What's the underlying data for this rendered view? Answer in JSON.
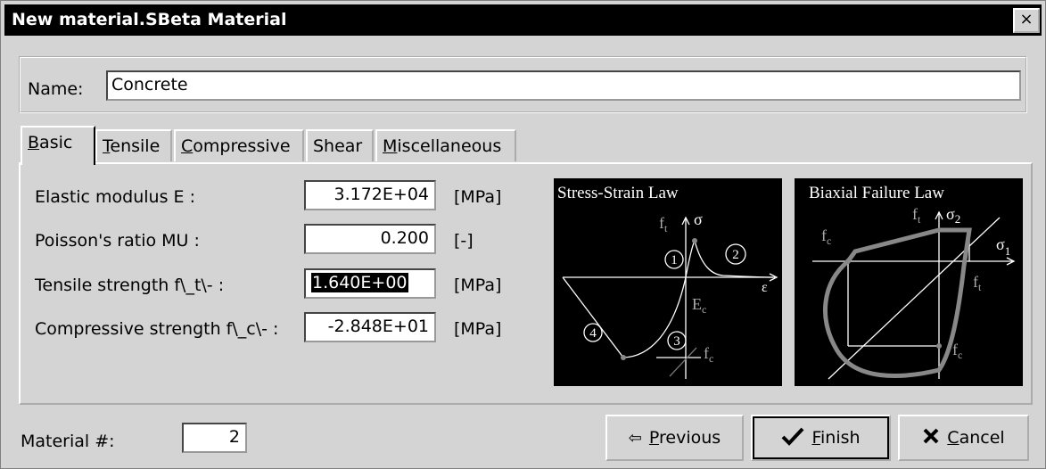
{
  "window": {
    "title": "New material.SBeta Material",
    "close_label": "×"
  },
  "name": {
    "label": "Name:",
    "value": "Concrete"
  },
  "tabs": [
    {
      "pre": "",
      "u": "B",
      "post": "asic",
      "active": true
    },
    {
      "pre": "",
      "u": "T",
      "post": "ensile",
      "active": false
    },
    {
      "pre": "",
      "u": "C",
      "post": "ompressive",
      "active": false
    },
    {
      "pre": "Shear",
      "u": "",
      "post": "",
      "active": false
    },
    {
      "pre": "",
      "u": "M",
      "post": "iscellaneous",
      "active": false
    }
  ],
  "params": [
    {
      "label": "Elastic modulus E :",
      "value": "3.172E+04",
      "unit": "[MPa]"
    },
    {
      "label": "Poisson's ratio MU :",
      "value": "0.200",
      "unit": "[-]"
    },
    {
      "label": "Tensile strength f\\_t\\- :",
      "value": "1.640E+00",
      "unit": "[MPa]"
    },
    {
      "label": "Compressive strength f\\_c\\- :",
      "value": "-2.848E+01",
      "unit": "[MPa]"
    }
  ],
  "diagrams": {
    "stress_strain": {
      "title": "Stress-Strain Law",
      "ft": "f",
      "ft_sub": "t",
      "sigma": "σ",
      "eps": "ε",
      "ec": "E",
      "ec_sub": "c",
      "fc": "f",
      "fc_sub": "c",
      "n1": "1",
      "n2": "2",
      "n3": "3",
      "n4": "4"
    },
    "biaxial": {
      "title": "Biaxial Failure Law",
      "ft_top": "f",
      "ft_top_sub": "t",
      "sigma2": "σ",
      "sigma2_sub": "2",
      "sigma1": "σ",
      "sigma1_sub": "1",
      "fc_left": "f",
      "fc_left_sub": "c",
      "ft_right": "f",
      "ft_right_sub": "t",
      "fc_bottom": "f",
      "fc_bottom_sub": "c"
    }
  },
  "material": {
    "label": "Material #:",
    "value": "2"
  },
  "buttons": {
    "previous": {
      "pre": "",
      "u": "P",
      "post": "revious"
    },
    "finish": {
      "pre": "",
      "u": "F",
      "post": "inish"
    },
    "cancel": {
      "pre": "",
      "u": "C",
      "post": "ancel"
    }
  }
}
